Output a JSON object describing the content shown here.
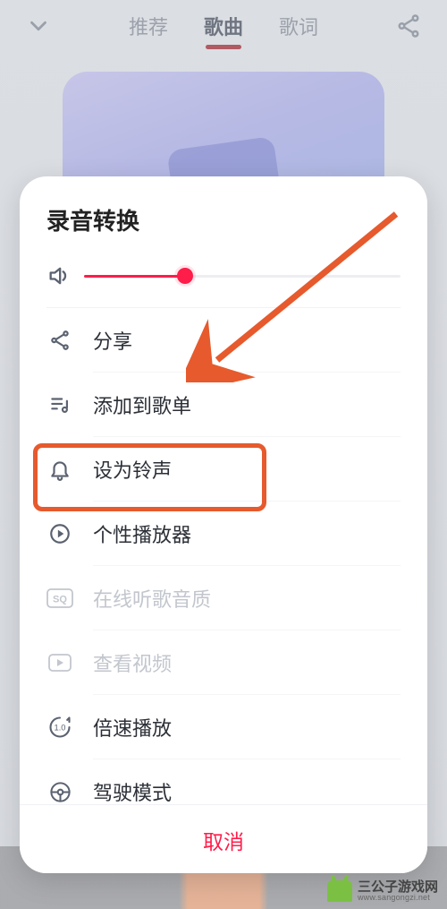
{
  "header": {
    "tabs": [
      "推荐",
      "歌曲",
      "歌词"
    ],
    "activeIndex": 1
  },
  "sheet": {
    "title": "录音转换",
    "volume_percent": 32,
    "items": [
      {
        "id": "share",
        "label": "分享",
        "disabled": false
      },
      {
        "id": "add-playlist",
        "label": "添加到歌单",
        "disabled": false,
        "highlighted": true
      },
      {
        "id": "ringtone",
        "label": "设为铃声",
        "disabled": false
      },
      {
        "id": "player-skin",
        "label": "个性播放器",
        "disabled": false
      },
      {
        "id": "quality",
        "label": "在线听歌音质",
        "disabled": true
      },
      {
        "id": "video",
        "label": "查看视频",
        "disabled": true
      },
      {
        "id": "speed",
        "label": "倍速播放",
        "disabled": false
      },
      {
        "id": "drive",
        "label": "驾驶模式",
        "disabled": false
      }
    ],
    "cancel": "取消"
  },
  "watermark": {
    "cn": "三公子游戏网",
    "domain": "www.sangongzi.net"
  },
  "annotation": {
    "type": "arrow-and-box",
    "target_item_id": "add-playlist",
    "color": "#e65a2d"
  }
}
